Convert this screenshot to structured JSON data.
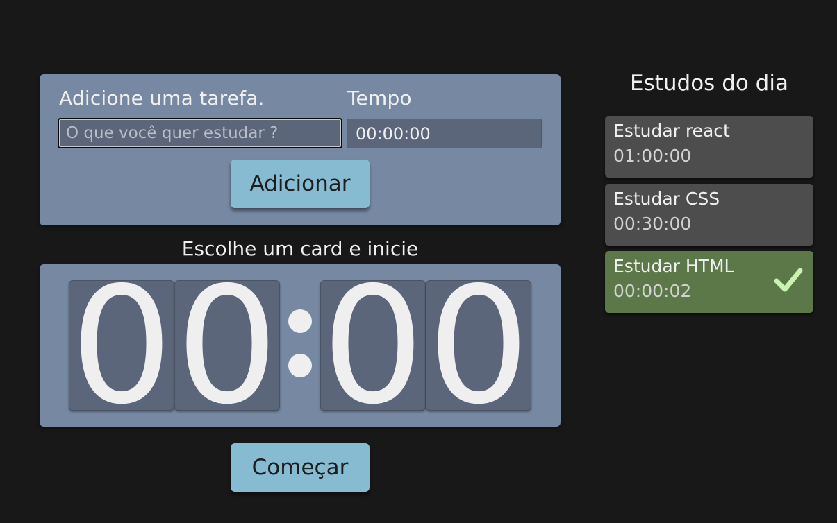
{
  "form": {
    "task_label": "Adicione uma tarefa.",
    "task_placeholder": "O que você quer estudar ?",
    "time_label": "Tempo",
    "time_value": "00:00:00",
    "add_button": "Adicionar"
  },
  "timer": {
    "title": "Escolhe um card e inicie",
    "digits": [
      "0",
      "0",
      "0",
      "0"
    ],
    "start_button": "Começar"
  },
  "sidebar": {
    "title": "Estudos do dia",
    "items": [
      {
        "name": "Estudar react",
        "time": "01:00:00",
        "completed": false
      },
      {
        "name": "Estudar CSS",
        "time": "00:30:00",
        "completed": false
      },
      {
        "name": "Estudar HTML",
        "time": "00:00:02",
        "completed": true,
        "icon": "check-icon"
      }
    ]
  },
  "colors": {
    "background": "#181818",
    "panel": "#7688a2",
    "digit_box": "#5c667a",
    "button": "#86bbd2",
    "card": "#4d4d4d",
    "card_completed": "#5c7848",
    "check": "#c9f3b0"
  }
}
